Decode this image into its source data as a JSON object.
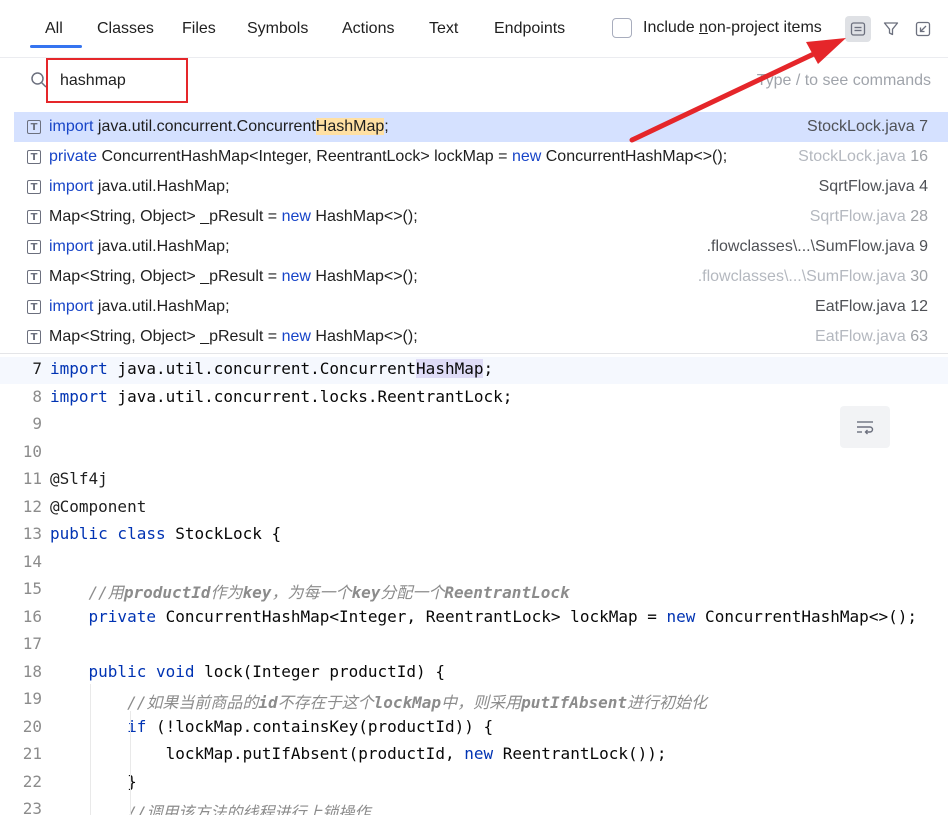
{
  "tabs": [
    {
      "label": "All"
    },
    {
      "label": "Classes"
    },
    {
      "label": "Files"
    },
    {
      "label": "Symbols"
    },
    {
      "label": "Actions"
    },
    {
      "label": "Text"
    },
    {
      "label": "Endpoints"
    }
  ],
  "include_option": {
    "label_pre": "Include ",
    "label_mn": "n",
    "label_post": "on-project items",
    "checked": false
  },
  "toolbar_icons": [
    "preview-panel-icon",
    "filter-icon",
    "open-in-window-icon"
  ],
  "search": {
    "value": "hashmap",
    "hint": "Type / to see commands"
  },
  "results": [
    {
      "segs": [
        [
          "kw",
          "import"
        ],
        [
          "t",
          " java.util.concurrent.Concurrent"
        ],
        [
          "hl",
          "HashMap"
        ],
        [
          "t",
          ";"
        ]
      ],
      "file": "StockLock.java",
      "line": "7",
      "selected": true,
      "dim": false
    },
    {
      "segs": [
        [
          "kw",
          "private"
        ],
        [
          "t",
          " ConcurrentHashMap<Integer, ReentrantLock> lockMap = "
        ],
        [
          "kw",
          "new"
        ],
        [
          "t",
          " ConcurrentHashMap<>();"
        ]
      ],
      "file": "StockLock.java",
      "line": "16",
      "selected": false,
      "dim": true
    },
    {
      "segs": [
        [
          "kw",
          "import"
        ],
        [
          "t",
          " java.util.HashMap;"
        ]
      ],
      "file": "SqrtFlow.java",
      "line": "4",
      "selected": false,
      "dim": false
    },
    {
      "segs": [
        [
          "t",
          "Map<String, Object> _pResult = "
        ],
        [
          "kw",
          "new"
        ],
        [
          "t",
          " HashMap<>();"
        ]
      ],
      "file": "SqrtFlow.java",
      "line": "28",
      "selected": false,
      "dim": true
    },
    {
      "segs": [
        [
          "kw",
          "import"
        ],
        [
          "t",
          " java.util.HashMap;"
        ]
      ],
      "file": ".flowclasses\\...\\SumFlow.java",
      "line": "9",
      "selected": false,
      "dim": false
    },
    {
      "segs": [
        [
          "t",
          "Map<String, Object> _pResult = "
        ],
        [
          "kw",
          "new"
        ],
        [
          "t",
          " HashMap<>();"
        ]
      ],
      "file": ".flowclasses\\...\\SumFlow.java",
      "line": "30",
      "selected": false,
      "dim": true
    },
    {
      "segs": [
        [
          "kw",
          "import"
        ],
        [
          "t",
          " java.util.HashMap;"
        ]
      ],
      "file": "EatFlow.java",
      "line": "12",
      "selected": false,
      "dim": false
    },
    {
      "segs": [
        [
          "t",
          "Map<String, Object> _pResult = "
        ],
        [
          "kw",
          "new"
        ],
        [
          "t",
          " HashMap<>();"
        ]
      ],
      "file": "EatFlow.java",
      "line": "63",
      "selected": false,
      "dim": true
    }
  ],
  "editor": {
    "current_line": "7",
    "lines": [
      {
        "num": "7",
        "segs": [
          [
            "ck",
            "import"
          ],
          [
            "t",
            " java.util.concurrent.Concurrent"
          ],
          [
            "hl2",
            "HashMap"
          ],
          [
            "t",
            ";"
          ]
        ]
      },
      {
        "num": "8",
        "segs": [
          [
            "ck",
            "import"
          ],
          [
            "t",
            " java.util.concurrent.locks.ReentrantLock;"
          ]
        ]
      },
      {
        "num": "9",
        "segs": []
      },
      {
        "num": "10",
        "segs": []
      },
      {
        "num": "11",
        "segs": [
          [
            "ann",
            "@Slf4j"
          ]
        ]
      },
      {
        "num": "12",
        "segs": [
          [
            "ann",
            "@Component"
          ]
        ]
      },
      {
        "num": "13",
        "segs": [
          [
            "ck",
            "public class"
          ],
          [
            "t",
            " StockLock {"
          ]
        ]
      },
      {
        "num": "14",
        "segs": []
      },
      {
        "num": "15",
        "segs": [
          [
            "t",
            "    "
          ],
          [
            "cm",
            "//用"
          ],
          [
            "cmb",
            "productId"
          ],
          [
            "cm",
            "作为"
          ],
          [
            "cmb",
            "key"
          ],
          [
            "cm",
            "，为每一个"
          ],
          [
            "cmb",
            "key"
          ],
          [
            "cm",
            "分配一个"
          ],
          [
            "cmb",
            "ReentrantLock"
          ]
        ]
      },
      {
        "num": "16",
        "segs": [
          [
            "t",
            "    "
          ],
          [
            "ck",
            "private"
          ],
          [
            "t",
            " ConcurrentHashMap<Integer, ReentrantLock> lockMap = "
          ],
          [
            "ck",
            "new"
          ],
          [
            "t",
            " ConcurrentHashMap<>();"
          ]
        ]
      },
      {
        "num": "17",
        "segs": []
      },
      {
        "num": "18",
        "segs": [
          [
            "t",
            "    "
          ],
          [
            "ck",
            "public void"
          ],
          [
            "t",
            " lock(Integer productId) {"
          ]
        ]
      },
      {
        "num": "19",
        "segs": [
          [
            "t",
            "        "
          ],
          [
            "cm",
            "//如果当前商品的"
          ],
          [
            "cmb",
            "id"
          ],
          [
            "cm",
            "不存在于这个"
          ],
          [
            "cmb",
            "lockMap"
          ],
          [
            "cm",
            "中，则采用"
          ],
          [
            "cmb",
            "putIfAbsent"
          ],
          [
            "cm",
            "进行初始化"
          ]
        ]
      },
      {
        "num": "20",
        "segs": [
          [
            "t",
            "        "
          ],
          [
            "ck",
            "if"
          ],
          [
            "t",
            " (!lockMap.containsKey(productId)) {"
          ]
        ]
      },
      {
        "num": "21",
        "segs": [
          [
            "t",
            "            lockMap.putIfAbsent(productId, "
          ],
          [
            "ck",
            "new"
          ],
          [
            "t",
            " ReentrantLock());"
          ]
        ]
      },
      {
        "num": "22",
        "segs": [
          [
            "t",
            "        }"
          ]
        ]
      },
      {
        "num": "23",
        "segs": [
          [
            "t",
            "        "
          ],
          [
            "cm",
            "//调用该方法的线程进行上锁操作"
          ]
        ]
      }
    ]
  },
  "colors": {
    "accent": "#3574f0",
    "selection": "#d5e1ff",
    "keyword": "#0033b3",
    "annotation_red": "#e5262a"
  }
}
